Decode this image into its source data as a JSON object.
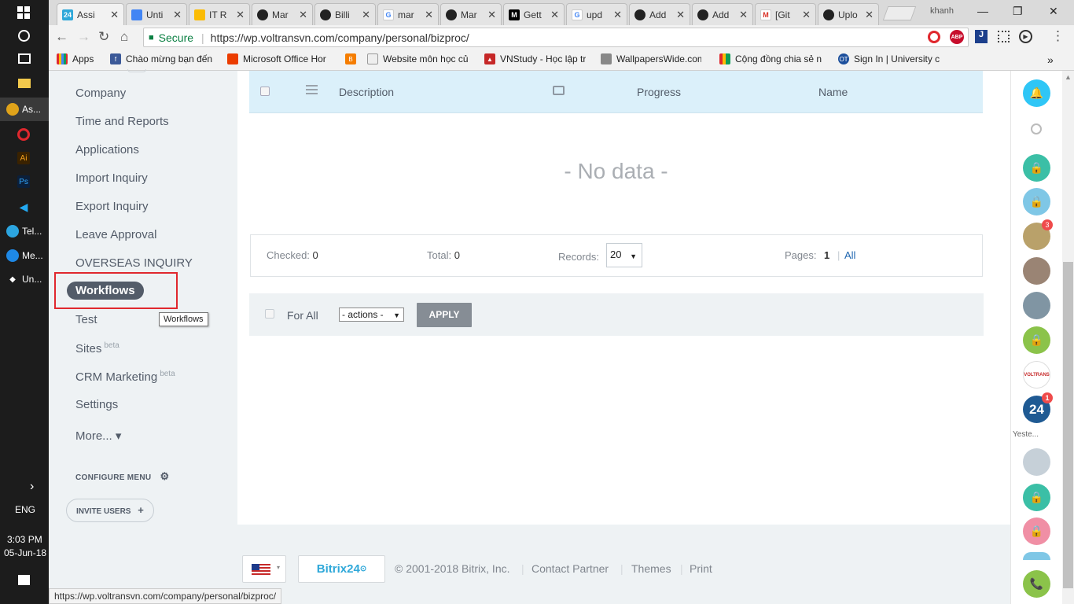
{
  "taskbar": {
    "items": [
      {
        "label": "As..."
      },
      {
        "label": "Tel..."
      },
      {
        "label": "Me..."
      },
      {
        "label": "Un..."
      }
    ],
    "lang": "ENG",
    "time": "3:03 PM",
    "date": "05-Jun-18"
  },
  "browser": {
    "user": "khanh",
    "tabs": [
      {
        "title": "Assi",
        "icon": "bitrix24-icon"
      },
      {
        "title": "Unti",
        "icon": "docs-icon"
      },
      {
        "title": "IT R",
        "icon": "drive-icon"
      },
      {
        "title": "Mar",
        "icon": "github-icon"
      },
      {
        "title": "Billi",
        "icon": "github-icon"
      },
      {
        "title": "mar",
        "icon": "google-icon"
      },
      {
        "title": "Mar",
        "icon": "github-icon"
      },
      {
        "title": "Gett",
        "icon": "medium-icon"
      },
      {
        "title": "upd",
        "icon": "google-icon"
      },
      {
        "title": "Add",
        "icon": "github-icon"
      },
      {
        "title": "Add",
        "icon": "github-icon"
      },
      {
        "title": "[Git",
        "icon": "gmail-icon"
      },
      {
        "title": "Uplo",
        "icon": "github-icon"
      }
    ],
    "secure_label": "Secure",
    "url": "https://wp.voltransvn.com/company/personal/bizproc/",
    "bookmarks": [
      {
        "label": "Apps"
      },
      {
        "label": "Chào mừng bạn đến"
      },
      {
        "label": "Microsoft Office Hor"
      },
      {
        "label": ""
      },
      {
        "label": "Website môn học củ"
      },
      {
        "label": "VNStudy - Học lập tr"
      },
      {
        "label": "WallpapersWide.com"
      },
      {
        "label": "Cộng đồng chia sẻ n"
      },
      {
        "label": "Sign In | University c"
      }
    ],
    "more_bookmarks": "»"
  },
  "sidebar": {
    "items": [
      "Company",
      "Time and Reports",
      "Applications",
      "Import Inquiry",
      "Export Inquiry",
      "Leave Approval",
      "OVERSEAS INQUIRY"
    ],
    "active": "Workflows",
    "tooltip": "Workflows",
    "items2": [
      {
        "label": "Test",
        "sup": ""
      },
      {
        "label": "Sites",
        "sup": "beta"
      },
      {
        "label": "CRM Marketing",
        "sup": "beta"
      },
      {
        "label": "Settings",
        "sup": ""
      },
      {
        "label": "More... ▾",
        "sup": ""
      }
    ],
    "configure": "CONFIGURE MENU",
    "invite": "INVITE USERS"
  },
  "grid": {
    "columns": {
      "description": "Description",
      "progress": "Progress",
      "name": "Name"
    },
    "empty": "- No data -",
    "checked_label": "Checked:",
    "checked_value": "0",
    "total_label": "Total:",
    "total_value": "0",
    "records_label": "Records:",
    "records_value": "20",
    "pages_label": "Pages:",
    "page_current": "1",
    "page_all": "All",
    "for_all": "For All",
    "actions_select": "- actions -",
    "apply": "APPLY"
  },
  "footer": {
    "brand": "Bitrix24",
    "copyright": "© 2001-2018 Bitrix, Inc.",
    "contact": "Contact Partner",
    "themes": "Themes",
    "print": "Print"
  },
  "rightbar": {
    "badge1": "3",
    "badge2": "1",
    "yesterday": "Yeste..."
  },
  "status_url": "https://wp.voltransvn.com/company/personal/bizproc/"
}
